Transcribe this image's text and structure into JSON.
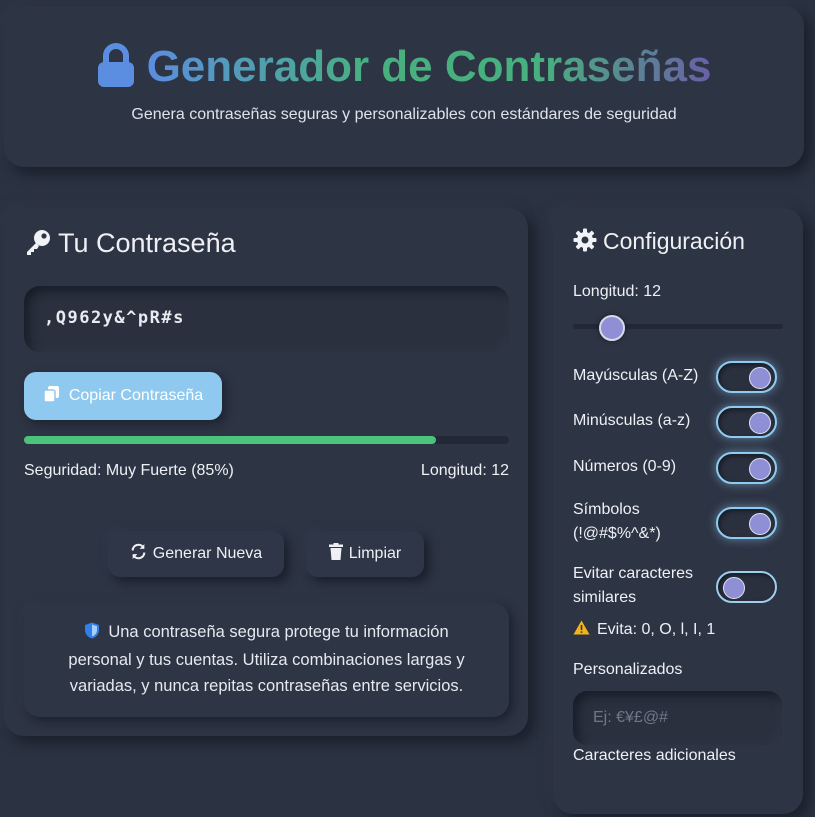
{
  "header": {
    "title": "Generador de Contraseñas",
    "subtitle": "Genera contraseñas seguras y personalizables con estándares de seguridad",
    "icon": "lock-icon"
  },
  "password_panel": {
    "title": "Tu Contraseña",
    "icon": "key-icon",
    "password": ",Q962y&^pR#s",
    "copy_label": "Copiar Contraseña",
    "strength_percent": 85,
    "strength_text": "Seguridad: Muy Fuerte (85%)",
    "length_text": "Longitud: 12",
    "generate_label": "Generar Nueva",
    "clear_label": "Limpiar",
    "info_text": "Una contraseña segura protege tu información personal y tus cuentas. Utiliza combinaciones largas y variadas, y nunca repitas contraseñas entre servicios."
  },
  "config": {
    "title": "Configuración",
    "icon": "gear-icon",
    "length_label": "Longitud: 12",
    "length_value": 12,
    "length_min": 8,
    "length_max": 64,
    "options": [
      {
        "label": "Mayúsculas (A-Z)",
        "on": true
      },
      {
        "label": "Minúsculas (a-z)",
        "on": true
      },
      {
        "label": "Números (0-9)",
        "on": true
      },
      {
        "label": "Símbolos (!@#$%^&*)",
        "on": true
      },
      {
        "label": "Evitar caracteres similares",
        "on": false
      }
    ],
    "avoid_text": "Evita: 0, O, l, I, 1",
    "custom_label": "Personalizados",
    "custom_placeholder": "Ej: €¥£@#",
    "custom_help": "Caracteres adicionales"
  },
  "colors": {
    "accent": "#90c9ef",
    "strength": "#4cc37a",
    "knob": "#8f8fd6",
    "background": "#2b3241"
  }
}
